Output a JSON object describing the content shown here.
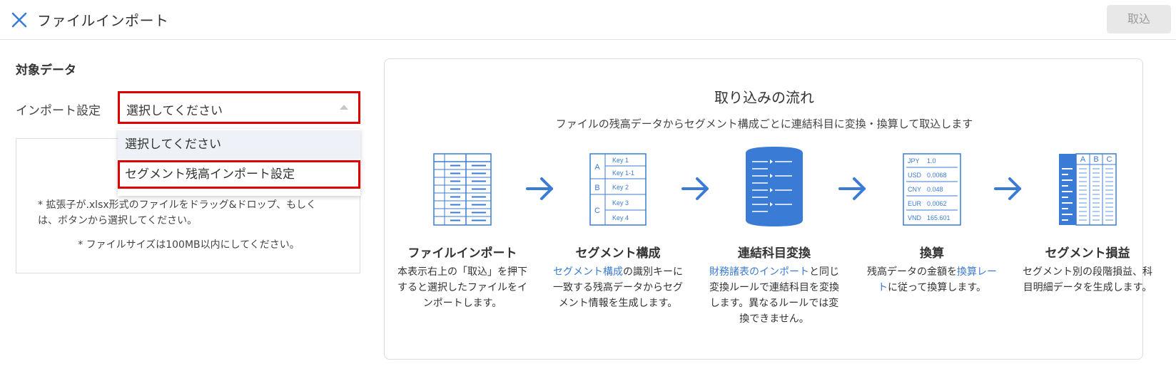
{
  "header": {
    "title": "ファイルインポート",
    "import_label": "取込"
  },
  "form": {
    "section_title": "対象データ",
    "setting_label": "インポート設定",
    "select_value": "選択してください",
    "options": [
      "選択してください",
      "セグメント残高インポート設定"
    ]
  },
  "dropzone": {
    "text1": "* 拡張子が.xlsx形式のファイルをドラッグ&ドロップ、もしくは、ボタンから選択してください。",
    "text2": "* ファイルサイズは100MB以内にしてください。"
  },
  "flow": {
    "title": "取り込みの流れ",
    "subtitle": "ファイルの残高データからセグメント構成ごとに連結科目に変換・換算して取込します",
    "steps": [
      {
        "heading": "ファイルインポート",
        "desc": "本表示右上の「取込」を押下すると選択したファイルをインポートします。"
      },
      {
        "heading": "セグメント構成",
        "desc_link": "セグメント構成",
        "desc_rest": "の識別キーに一致する残高データからセグメント情報を生成します。",
        "keys": [
          "Key 1",
          "Key 1-1",
          "Key 2",
          "Key 3",
          "Key 4"
        ],
        "groups": [
          "A",
          "B",
          "C"
        ]
      },
      {
        "heading": "連結科目変換",
        "desc_link": "財務諸表のインポート",
        "desc_rest": "と同じ変換ルールで連結科目を変換します。異なるルールでは変換できません。"
      },
      {
        "heading": "換算",
        "desc_pre": "残高データの金額を",
        "desc_link": "換算レート",
        "desc_rest": "に従って換算します。",
        "rates": [
          {
            "code": "JPY",
            "rate": "1.0"
          },
          {
            "code": "USD",
            "rate": "0.0068"
          },
          {
            "code": "CNY",
            "rate": "0.048"
          },
          {
            "code": "EUR",
            "rate": "0.0062"
          },
          {
            "code": "VND",
            "rate": "165.601"
          }
        ]
      },
      {
        "heading": "セグメント損益",
        "desc": "セグメント別の段階損益、科目明細データを生成します。",
        "columns": [
          "A",
          "B",
          "C"
        ]
      }
    ]
  },
  "colors": {
    "accent": "#3a7bd5",
    "highlight_border": "#e00000",
    "disabled_button": "#e8e8e8"
  }
}
